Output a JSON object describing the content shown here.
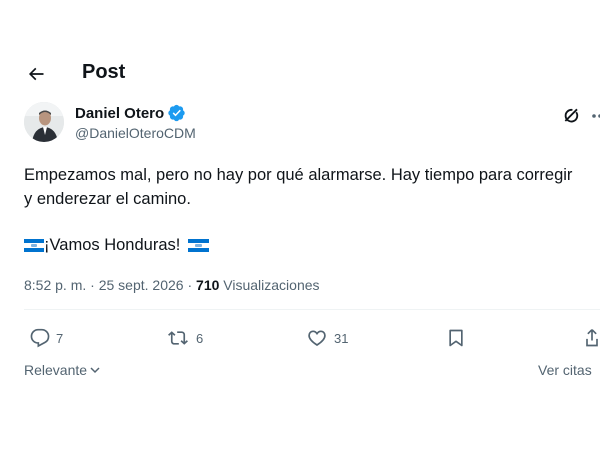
{
  "header": {
    "title": "Post"
  },
  "author": {
    "name": "Daniel Otero",
    "handle": "@DanielOteroCDM",
    "verified": true
  },
  "post": {
    "text": "Empezamos mal, pero no hay por qué alarmarse. Hay tiempo para corregir y enderezar el camino.",
    "line3": "¡Vamos Honduras!",
    "time": "8:52 p. m.",
    "date": "25 sept. 2026",
    "views_count": "710",
    "views_label": "Visualizaciones",
    "separator": "·"
  },
  "actions": {
    "replies": "7",
    "reposts": "6",
    "likes": "31"
  },
  "footer": {
    "sort_label": "Relevante",
    "quotes_label": "Ver citas"
  },
  "colors": {
    "verified": "#1d9bf0",
    "secondary_text": "#536471",
    "flag_blue": "#0073cf"
  },
  "icons": [
    "back-arrow-icon",
    "verified-badge-icon",
    "grok-icon",
    "reply-icon",
    "repost-icon",
    "like-icon",
    "bookmark-icon",
    "share-icon",
    "chevron-down-icon",
    "honduras-flag-icon"
  ]
}
